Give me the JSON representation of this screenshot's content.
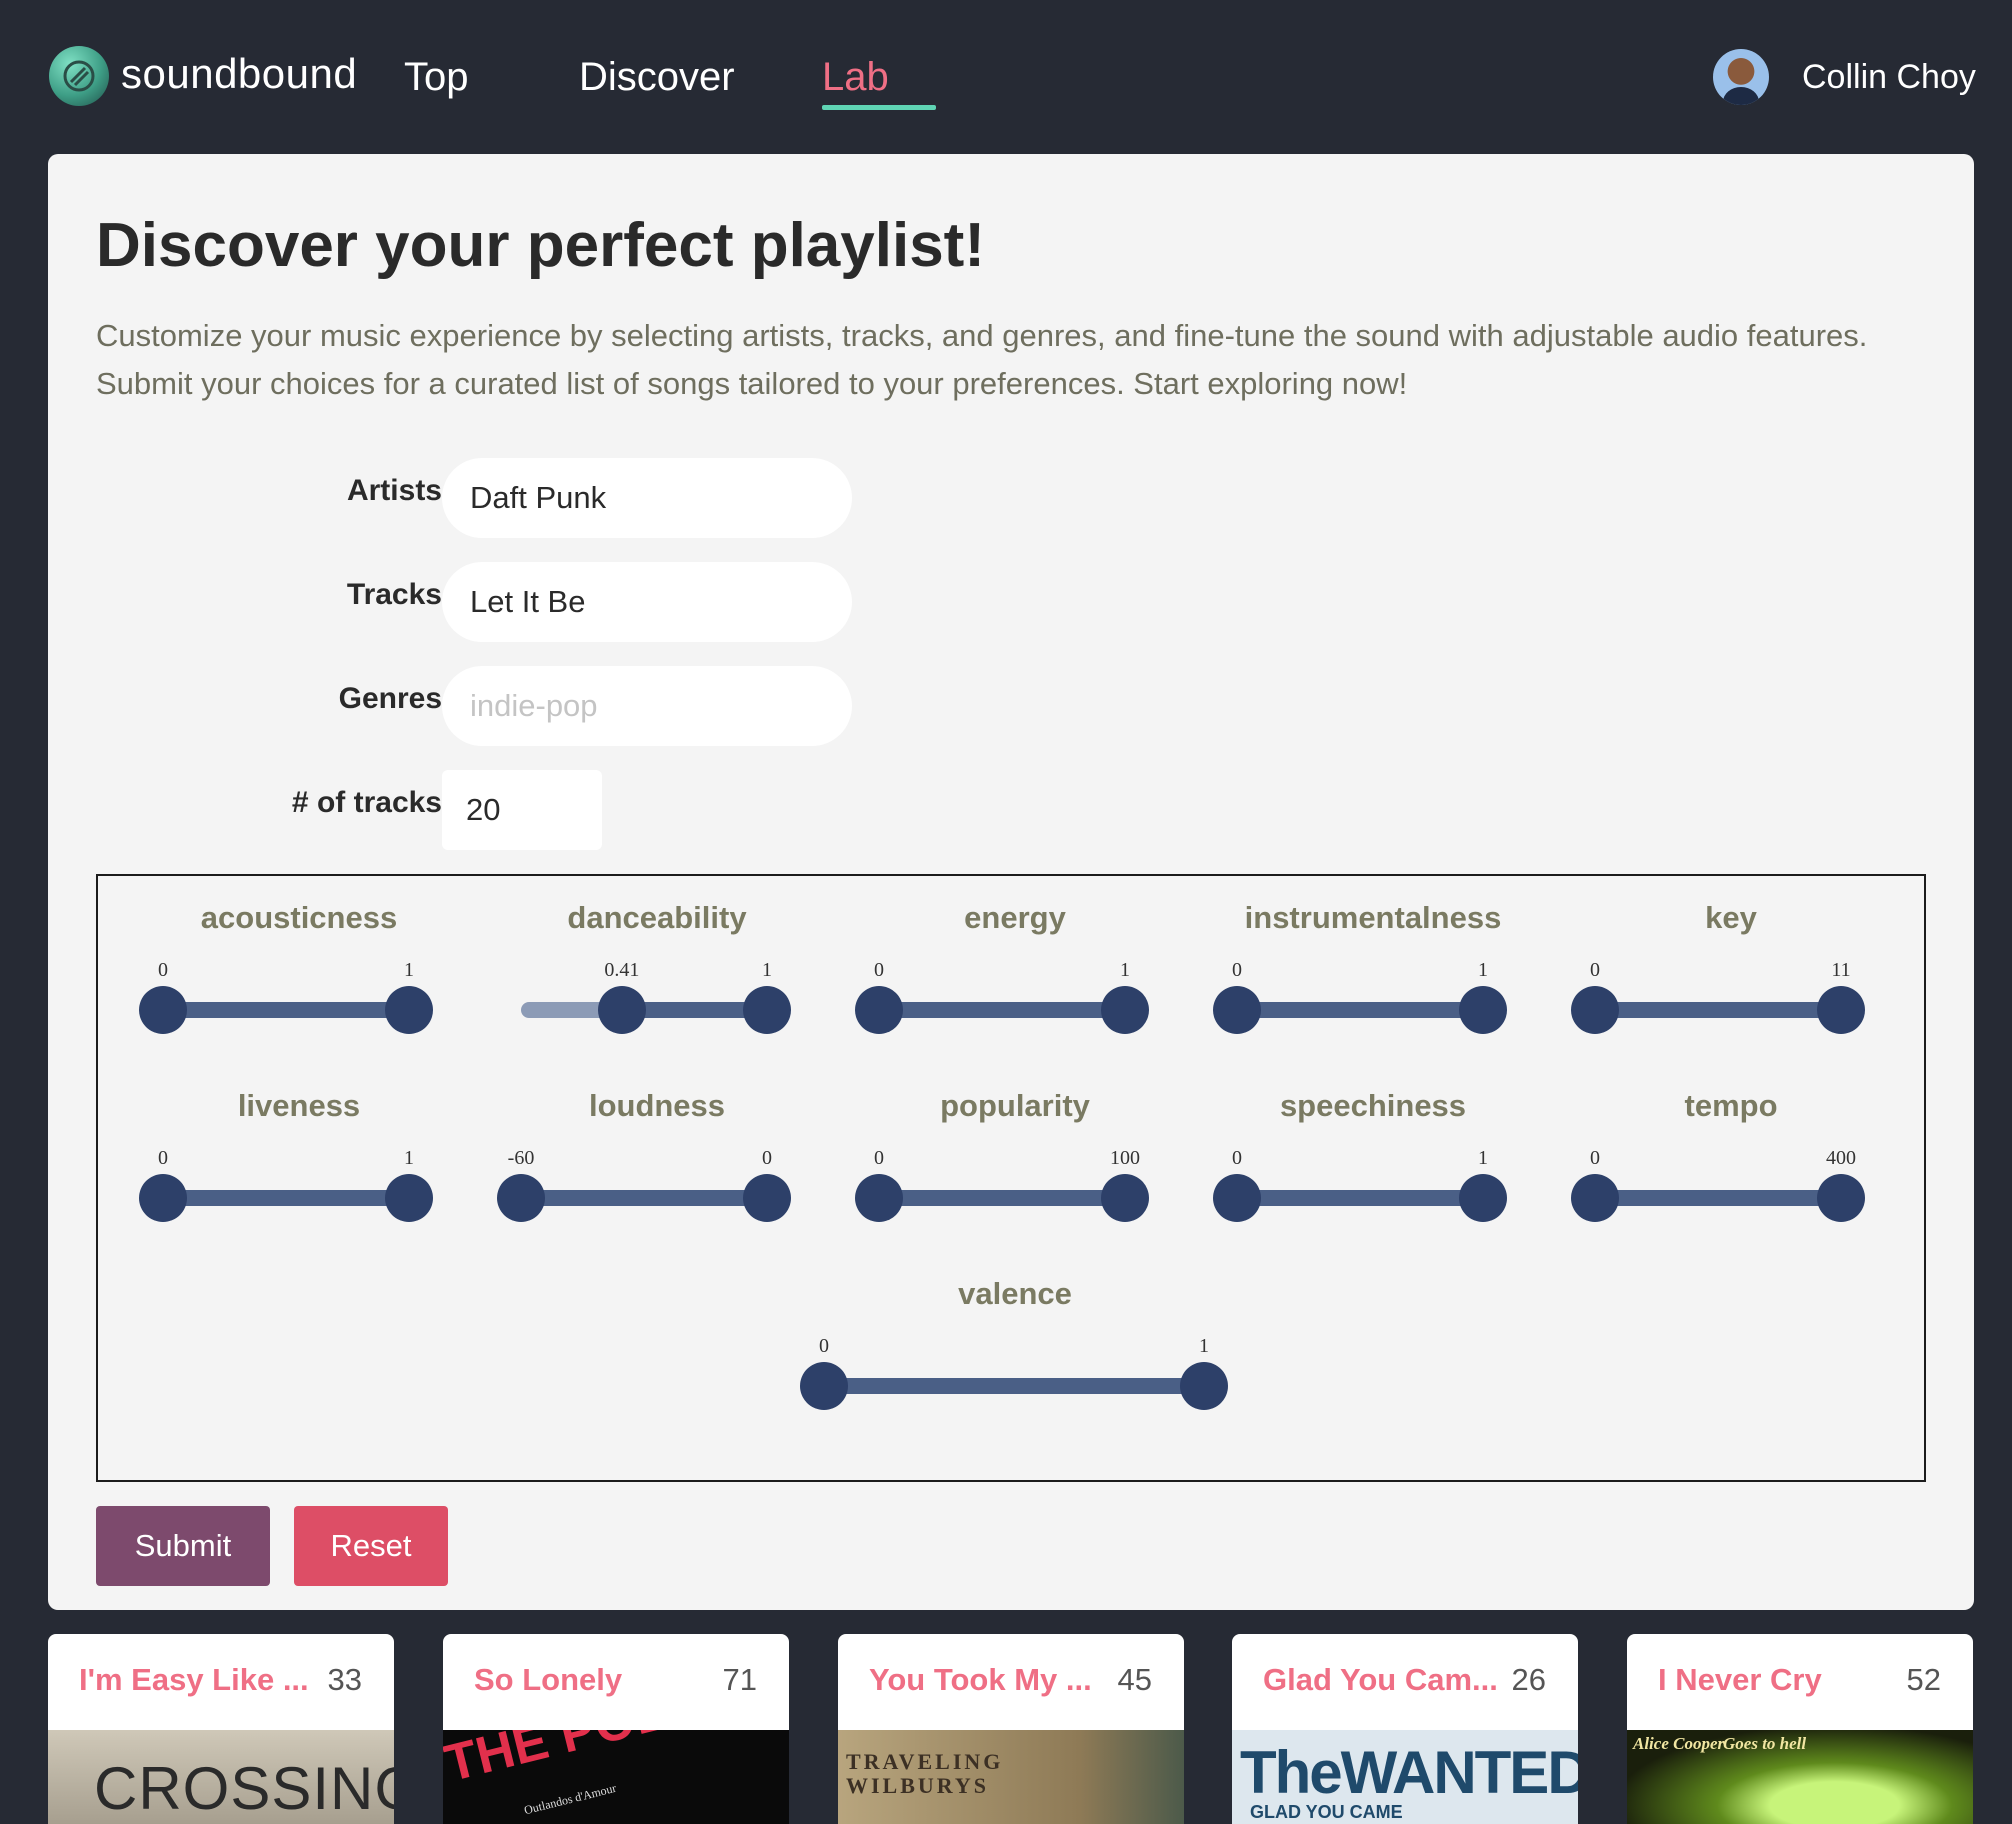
{
  "nav": {
    "brand": "soundbound",
    "links": [
      "Top",
      "Discover",
      "Lab"
    ],
    "active_link": "Lab",
    "user_name": "Collin Choy"
  },
  "colors": {
    "background": "#262a34",
    "card": "#f4f4f4",
    "accent_pink": "#ef6f85",
    "accent_teal": "#5fd4b4",
    "slider": "#2d4069",
    "submit": "#7d4a6d",
    "reset": "#dd4e66"
  },
  "page": {
    "title": "Discover your perfect playlist!",
    "description": "Customize your music experience by selecting artists, tracks, and genres, and fine-tune the sound with adjustable audio features. Submit your choices for a curated list of songs tailored to your preferences. Start exploring now!"
  },
  "form": {
    "artists_label": "Artists",
    "artists_value": "Daft Punk",
    "tracks_label": "Tracks",
    "tracks_value": "Let It Be",
    "genres_label": "Genres",
    "genres_placeholder": "indie-pop",
    "count_label": "# of tracks",
    "count_value": "20"
  },
  "features": [
    {
      "name": "acousticness",
      "low_label": "0",
      "high_label": "1",
      "min": 0,
      "max": 1,
      "low": 0,
      "high": 1
    },
    {
      "name": "danceability",
      "low_label": "0.41",
      "high_label": "1",
      "min": 0,
      "max": 1,
      "low": 0.41,
      "high": 1
    },
    {
      "name": "energy",
      "low_label": "0",
      "high_label": "1",
      "min": 0,
      "max": 1,
      "low": 0,
      "high": 1
    },
    {
      "name": "instrumentalness",
      "low_label": "0",
      "high_label": "1",
      "min": 0,
      "max": 1,
      "low": 0,
      "high": 1
    },
    {
      "name": "key",
      "low_label": "0",
      "high_label": "11",
      "min": 0,
      "max": 11,
      "low": 0,
      "high": 11
    },
    {
      "name": "liveness",
      "low_label": "0",
      "high_label": "1",
      "min": 0,
      "max": 1,
      "low": 0,
      "high": 1
    },
    {
      "name": "loudness",
      "low_label": "-60",
      "high_label": "0",
      "min": -60,
      "max": 0,
      "low": -60,
      "high": 0
    },
    {
      "name": "popularity",
      "low_label": "0",
      "high_label": "100",
      "min": 0,
      "max": 100,
      "low": 0,
      "high": 100
    },
    {
      "name": "speechiness",
      "low_label": "0",
      "high_label": "1",
      "min": 0,
      "max": 1,
      "low": 0,
      "high": 1
    },
    {
      "name": "tempo",
      "low_label": "0",
      "high_label": "400",
      "min": 0,
      "max": 400,
      "low": 0,
      "high": 400
    },
    {
      "name": "valence",
      "low_label": "0",
      "high_label": "1",
      "min": 0,
      "max": 1,
      "low": 0,
      "high": 1
    }
  ],
  "buttons": {
    "submit": "Submit",
    "reset": "Reset"
  },
  "results": [
    {
      "name": "I'm Easy Like ...",
      "popularity": "33",
      "cover_text": "CROSSING"
    },
    {
      "name": "So Lonely",
      "popularity": "71",
      "cover_text": "THE POLICE",
      "cover_subtext": "Outlandos d'Amour"
    },
    {
      "name": "You Took My ...",
      "popularity": "45",
      "cover_text": "TRAVELING WILBURYS"
    },
    {
      "name": "Glad You Cam...",
      "popularity": "26",
      "cover_text": "TheWANTED",
      "cover_subtext": "GLAD YOU CAME"
    },
    {
      "name": "I Never Cry",
      "popularity": "52",
      "cover_text": "Alice Cooper",
      "cover_subtext": "Goes to hell"
    }
  ]
}
